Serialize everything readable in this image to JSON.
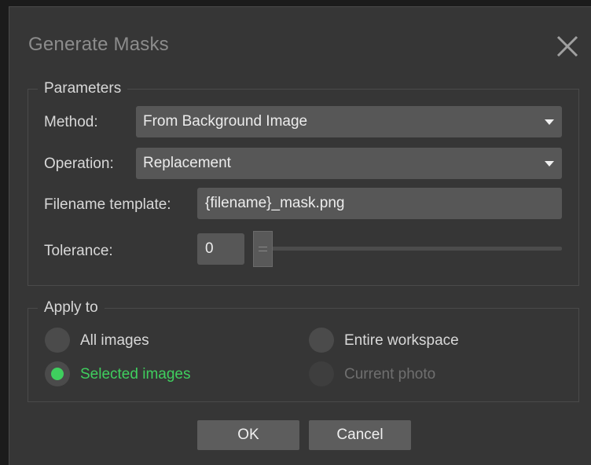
{
  "dialog": {
    "title": "Generate Masks",
    "close_icon": "close-icon"
  },
  "parameters": {
    "group_title": "Parameters",
    "method_label": "Method:",
    "method_value": "From Background Image",
    "operation_label": "Operation:",
    "operation_value": "Replacement",
    "filename_label": "Filename template:",
    "filename_value": "{filename}_mask.png",
    "tolerance_label": "Tolerance:",
    "tolerance_value": "0"
  },
  "apply_to": {
    "group_title": "Apply to",
    "options": [
      {
        "label": "All images",
        "checked": false,
        "enabled": true
      },
      {
        "label": "Selected images",
        "checked": true,
        "enabled": true
      },
      {
        "label": "Entire workspace",
        "checked": false,
        "enabled": true
      },
      {
        "label": "Current photo",
        "checked": false,
        "enabled": false
      }
    ]
  },
  "buttons": {
    "ok_label": "OK",
    "cancel_label": "Cancel"
  },
  "colors": {
    "dialog_bg": "#363636",
    "field_bg": "#575757",
    "accent_green": "#3fcf5e",
    "text": "#d8d8d8",
    "disabled_text": "#6f6f6f"
  }
}
